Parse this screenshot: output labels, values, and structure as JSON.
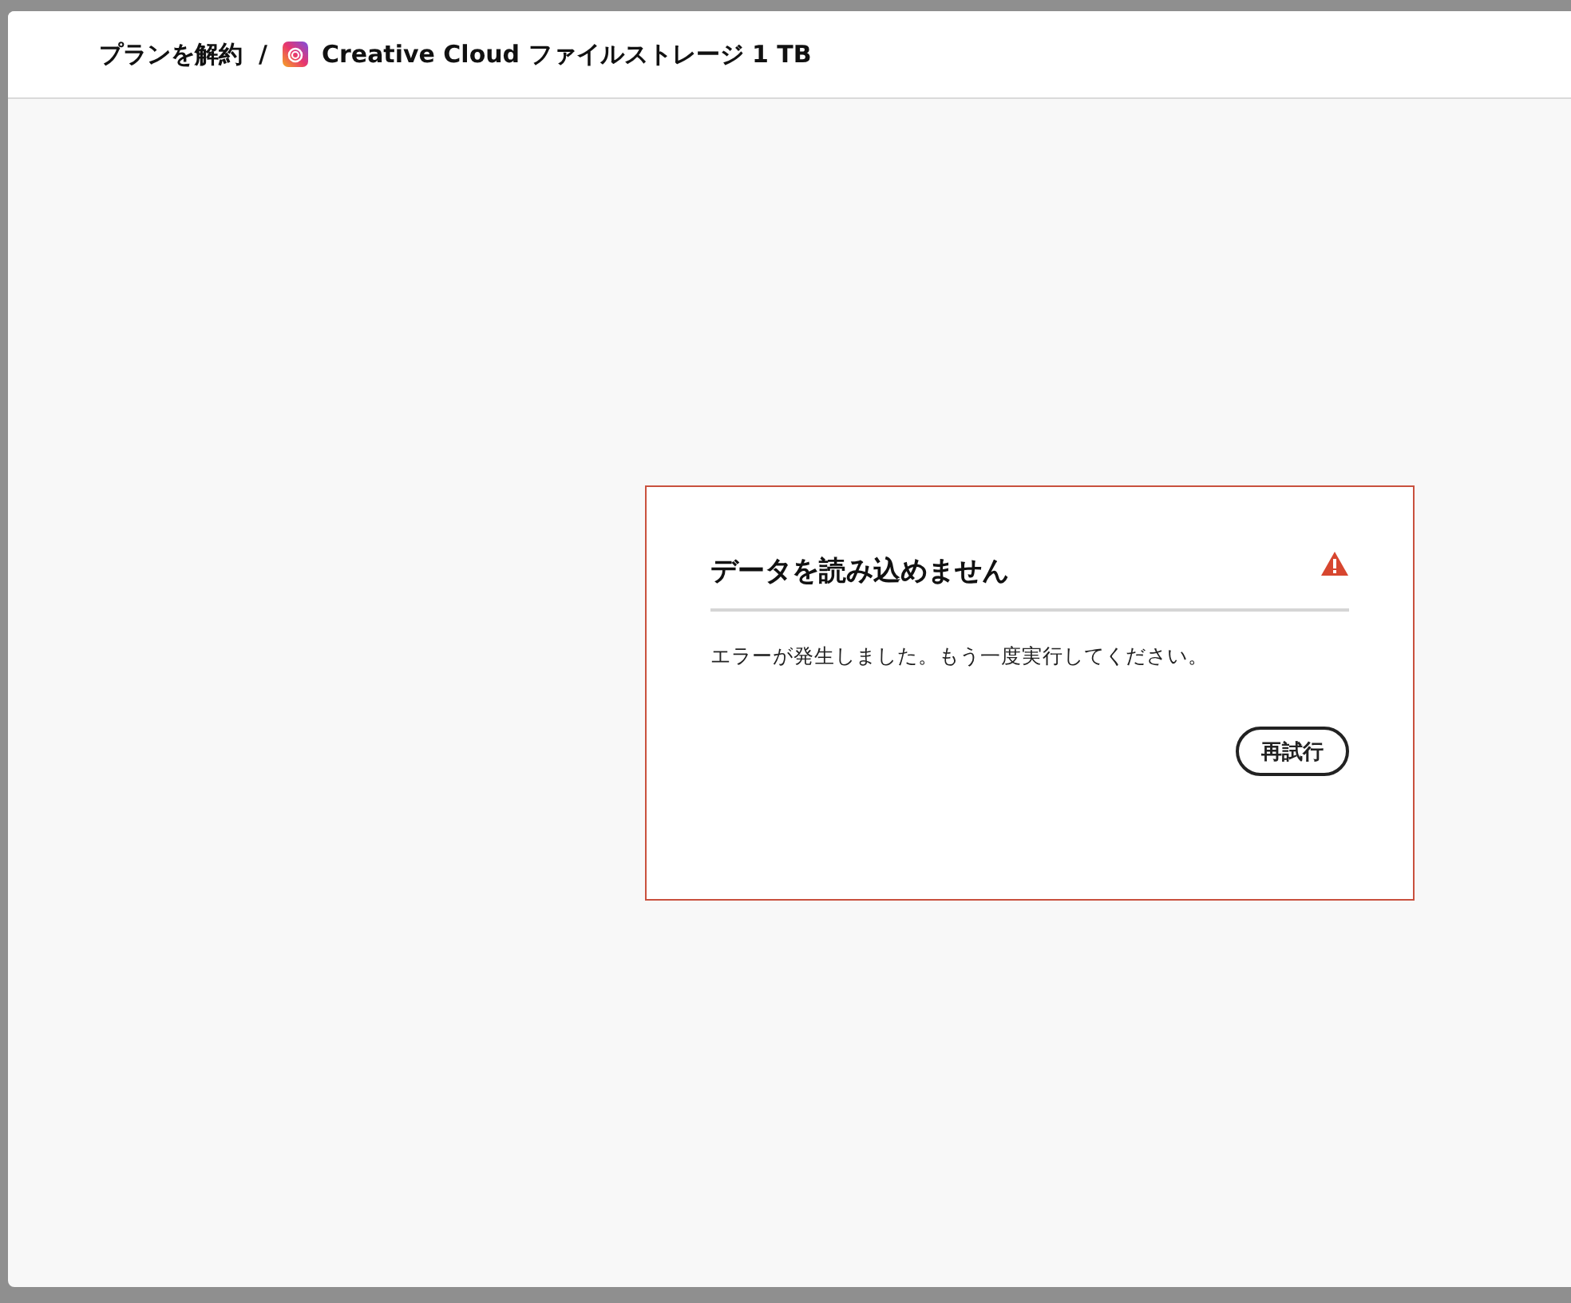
{
  "header": {
    "breadcrumb": [
      {
        "kind": "link",
        "label": "プランを解約"
      },
      {
        "kind": "separator",
        "label": "/"
      },
      {
        "kind": "product",
        "label": "Creative Cloud ファイルストレージ 1 TB"
      }
    ]
  },
  "error_card": {
    "title": "データを読み込めません",
    "message": "エラーが発生しました。もう一度実行してください。",
    "button": "再試行"
  }
}
